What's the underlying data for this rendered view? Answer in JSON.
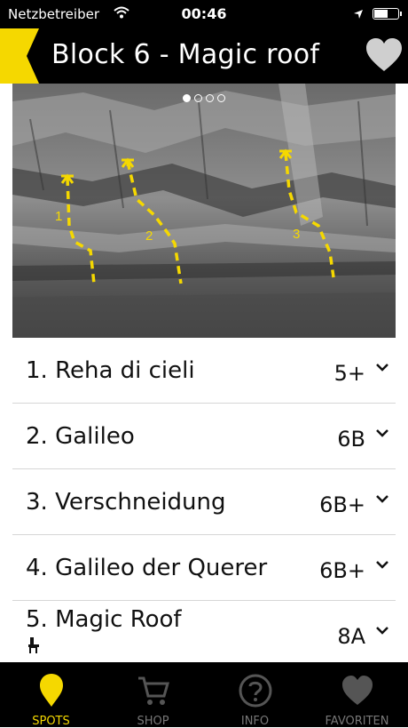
{
  "status_bar": {
    "carrier": "Netzbetreiber",
    "time": "00:46",
    "battery_level": 0.6
  },
  "header": {
    "title": "Block 6 - Magic roof"
  },
  "gallery": {
    "page_count": 4,
    "current_page": 1,
    "route_numbers": [
      "1",
      "2",
      "3"
    ]
  },
  "routes": [
    {
      "name": "1. Reha di cieli",
      "grade": "5+"
    },
    {
      "name": "2. Galileo",
      "grade": "6B"
    },
    {
      "name": "3. Verschneidung",
      "grade": "6B+"
    },
    {
      "name": "4. Galileo der Querer",
      "grade": "6B+"
    },
    {
      "name": "5. Magic Roof",
      "grade": "8A"
    }
  ],
  "tabbar": {
    "tabs": [
      {
        "label": "SPOTS",
        "active": true
      },
      {
        "label": "SHOP",
        "active": false
      },
      {
        "label": "INFO",
        "active": false
      },
      {
        "label": "FAVORITEN",
        "active": false
      }
    ]
  },
  "colors": {
    "accent": "#f5d800",
    "header_bg": "#000000",
    "inactive_icon": "#555555"
  }
}
